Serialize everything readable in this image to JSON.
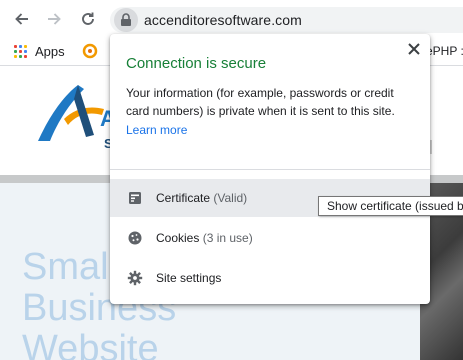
{
  "toolbar": {
    "url": "accenditoresoftware.com"
  },
  "bookmarks": {
    "apps_label": "Apps",
    "php_label": "ePHP :"
  },
  "page": {
    "hero_lines": [
      "Smal",
      "Business",
      "Website"
    ],
    "logo_letter": "A",
    "logo_sub": "S"
  },
  "popup": {
    "title": "Connection is secure",
    "description": "Your information (for example, passwords or credit card numbers) is private when it is sent to this site.",
    "learn_more": "Learn more",
    "items": [
      {
        "label": "Certificate",
        "sub": "(Valid)"
      },
      {
        "label": "Cookies",
        "sub": "(3 in use)"
      },
      {
        "label": "Site settings",
        "sub": ""
      }
    ]
  },
  "tooltip": {
    "text": "Show certificate (issued b"
  },
  "colors": {
    "secure_green": "#188038",
    "link_blue": "#1a73e8",
    "hover_row": "#e8eaed"
  }
}
